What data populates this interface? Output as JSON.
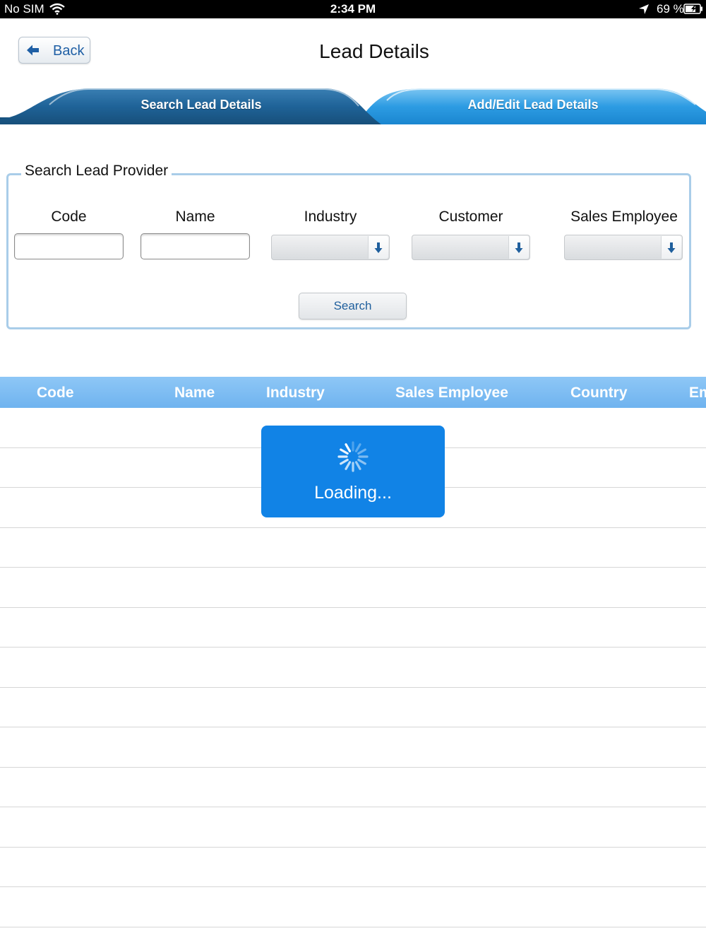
{
  "status_bar": {
    "carrier": "No SIM",
    "time": "2:34 PM",
    "battery": "69 %",
    "icons": [
      "wifi-icon",
      "location-arrow-icon",
      "battery-charging-icon"
    ]
  },
  "nav": {
    "back_label": "Back",
    "back_icon": "back-arrow-icon",
    "title": "Lead Details"
  },
  "tabs": [
    {
      "label": "Search Lead Details",
      "selected": true
    },
    {
      "label": "Add/Edit Lead Details",
      "selected": false
    }
  ],
  "search_form": {
    "legend": "Search Lead Provider",
    "fields": {
      "code": {
        "label": "Code",
        "value": "",
        "placeholder": ""
      },
      "name": {
        "label": "Name",
        "value": "",
        "placeholder": ""
      },
      "industry": {
        "label": "Industry",
        "value": ""
      },
      "customer": {
        "label": "Customer",
        "value": ""
      },
      "sales": {
        "label": "Sales Employee",
        "value": ""
      }
    },
    "dropdown_icon": "arrow-down-icon",
    "search_label": "Search"
  },
  "results_table": {
    "columns": [
      "Code",
      "Name",
      "Industry",
      "Sales Employee",
      "Country",
      "Em"
    ],
    "rows": [
      [],
      [],
      [],
      [],
      [],
      [],
      [],
      [],
      [],
      [],
      [],
      [],
      []
    ]
  },
  "loading": {
    "text": "Loading...",
    "icon": "spinner-icon"
  },
  "colors": {
    "tab_selected": "#1a5f91",
    "tab_unselected": "#2f9fe3",
    "table_header": "#7fbdf3",
    "loading_bg": "#1183e6",
    "fieldset_border": "#a9cde9",
    "link_blue": "#1f5fa5"
  }
}
